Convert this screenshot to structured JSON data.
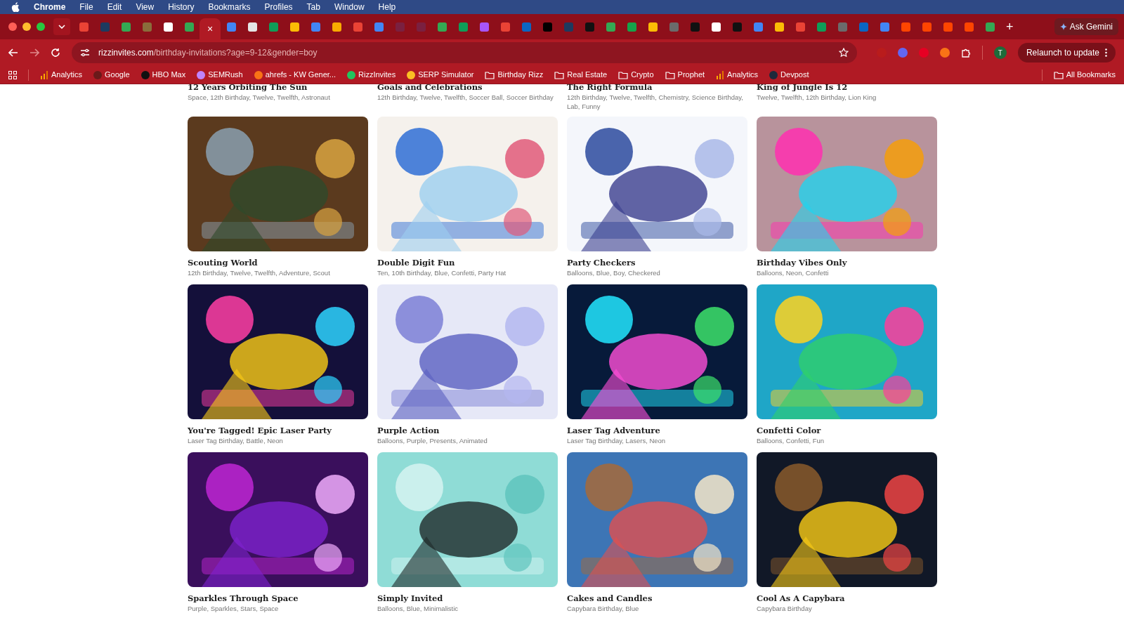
{
  "menu_bar": {
    "app": "Chrome",
    "items": [
      "File",
      "Edit",
      "View",
      "History",
      "Bookmarks",
      "Profiles",
      "Tab",
      "Window",
      "Help"
    ]
  },
  "tabs": [
    {
      "color": "#ea4335",
      "selected": false
    },
    {
      "color": "#1e3a5f",
      "selected": false
    },
    {
      "color": "#34a853",
      "selected": false
    },
    {
      "color": "#8a6d3b",
      "selected": false
    },
    {
      "color": "#ffffff",
      "selected": false
    },
    {
      "color": "#34a853",
      "selected": false
    },
    {
      "selected": true,
      "close": "×"
    },
    {
      "color": "#4285f4",
      "selected": false
    },
    {
      "color": "#e5e5e5",
      "selected": false
    },
    {
      "color": "#0f9d58",
      "selected": false
    },
    {
      "color": "#fbbc05",
      "selected": false
    },
    {
      "color": "#4285f4",
      "selected": false
    },
    {
      "color": "#f9ab00",
      "selected": false
    },
    {
      "color": "#ea4335",
      "selected": false
    },
    {
      "color": "#4285f4",
      "selected": false
    },
    {
      "color": "#7a2040",
      "selected": false
    },
    {
      "color": "#7a2040",
      "selected": false
    },
    {
      "color": "#34a853",
      "selected": false
    },
    {
      "color": "#0f9d58",
      "selected": false
    },
    {
      "color": "#a855f7",
      "selected": false
    },
    {
      "color": "#ea4335",
      "selected": false
    },
    {
      "color": "#0a66c2",
      "selected": false
    },
    {
      "color": "#000000",
      "selected": false
    },
    {
      "color": "#1e3a5f",
      "selected": false
    },
    {
      "color": "#111111",
      "selected": false
    },
    {
      "color": "#34a853",
      "selected": false
    },
    {
      "color": "#16a34a",
      "selected": false
    },
    {
      "color": "#fbbc05",
      "selected": false
    },
    {
      "color": "#6b6b6b",
      "selected": false
    },
    {
      "color": "#111111",
      "selected": false
    },
    {
      "color": "#ffffff",
      "selected": false
    },
    {
      "color": "#111111",
      "selected": false
    },
    {
      "color": "#4285f4",
      "selected": false
    },
    {
      "color": "#fbbc05",
      "selected": false
    },
    {
      "color": "#ea4335",
      "selected": false
    },
    {
      "color": "#0f9d58",
      "selected": false
    },
    {
      "color": "#6b6b6b",
      "selected": false
    },
    {
      "color": "#0a66c2",
      "selected": false
    },
    {
      "color": "#4285f4",
      "selected": false
    },
    {
      "color": "#ff4500",
      "selected": false
    },
    {
      "color": "#ff4500",
      "selected": false
    },
    {
      "color": "#ff4500",
      "selected": false
    },
    {
      "color": "#ff4500",
      "selected": false
    },
    {
      "color": "#34a853",
      "selected": false
    }
  ],
  "new_tab": "+",
  "ask_gemini": "Ask Gemini",
  "address": {
    "host": "rizzinvites.com",
    "path": "/birthday-invitations?age=9-12&gender=boy"
  },
  "extensions": [
    {
      "color": "#b91c1c"
    },
    {
      "color": "#6366f1"
    },
    {
      "color": "#e60023"
    },
    {
      "color": "#f97316"
    }
  ],
  "profile": "T",
  "relaunch": "Relaunch to update",
  "bookmarks": [
    {
      "kind": "chart",
      "label": "Analytics"
    },
    {
      "kind": "site",
      "label": "Google",
      "color": "#6b1a1a"
    },
    {
      "kind": "site",
      "label": "HBO Max",
      "color": "#111111"
    },
    {
      "kind": "site",
      "label": "SEMRush",
      "color": "#c084fc"
    },
    {
      "kind": "site",
      "label": "ahrefs - KW Gener...",
      "color": "#f97316"
    },
    {
      "kind": "site",
      "label": "RizzInvites",
      "color": "#22c55e"
    },
    {
      "kind": "site",
      "label": "SERP Simulator",
      "color": "#fbbf24"
    },
    {
      "kind": "folder",
      "label": "Birthday Rizz"
    },
    {
      "kind": "folder",
      "label": "Real Estate"
    },
    {
      "kind": "folder",
      "label": "Crypto"
    },
    {
      "kind": "folder",
      "label": "Prophet"
    },
    {
      "kind": "chart",
      "label": "Analytics"
    },
    {
      "kind": "site",
      "label": "Devpost",
      "color": "#1e293b"
    }
  ],
  "all_bookmarks": "All Bookmarks",
  "partial_row": [
    {
      "title": "12 Years Orbiting The Sun",
      "tags": "Space, 12th Birthday, Twelve, Twelfth, Astronaut"
    },
    {
      "title": "Goals and Celebrations",
      "tags": "12th Birthday, Twelve, Twelfth, Soccer Ball, Soccer Birthday"
    },
    {
      "title": "The Right Formula",
      "tags": "12th Birthday, Twelve, Twelfth, Chemistry, Science Birthday, Lab, Funny"
    },
    {
      "title": "King of Jungle Is 12",
      "tags": "Twelve, Twelfth, 12th Birthday, Lion King"
    }
  ],
  "cards": [
    {
      "title": "Scouting World",
      "tags": "12th Birthday, Twelve, Twelfth, Adventure, Scout"
    },
    {
      "title": "Double Digit Fun",
      "tags": "Ten, 10th Birthday, Blue, Confetti, Party Hat"
    },
    {
      "title": "Party Checkers",
      "tags": "Balloons, Blue, Boy, Checkered"
    },
    {
      "title": "Birthday Vibes Only",
      "tags": "Balloons, Neon, Confetti"
    },
    {
      "title": "You're Tagged! Epic Laser Party",
      "tags": "Laser Tag Birthday, Battle, Neon"
    },
    {
      "title": "Purple Action",
      "tags": "Balloons, Purple, Presents, Animated"
    },
    {
      "title": "Laser Tag Adventure",
      "tags": "Laser Tag Birthday, Lasers, Neon"
    },
    {
      "title": "Confetti Color",
      "tags": "Balloons, Confetti, Fun"
    },
    {
      "title": "Sparkles Through Space",
      "tags": "Purple, Sparkles, Stars, Space"
    },
    {
      "title": "Simply Invited",
      "tags": "Balloons, Blue, Minimalistic"
    },
    {
      "title": "Cakes and Candles",
      "tags": "Capybara Birthday, Blue"
    },
    {
      "title": "Cool As A Capybara",
      "tags": "Capybara Birthday"
    }
  ]
}
